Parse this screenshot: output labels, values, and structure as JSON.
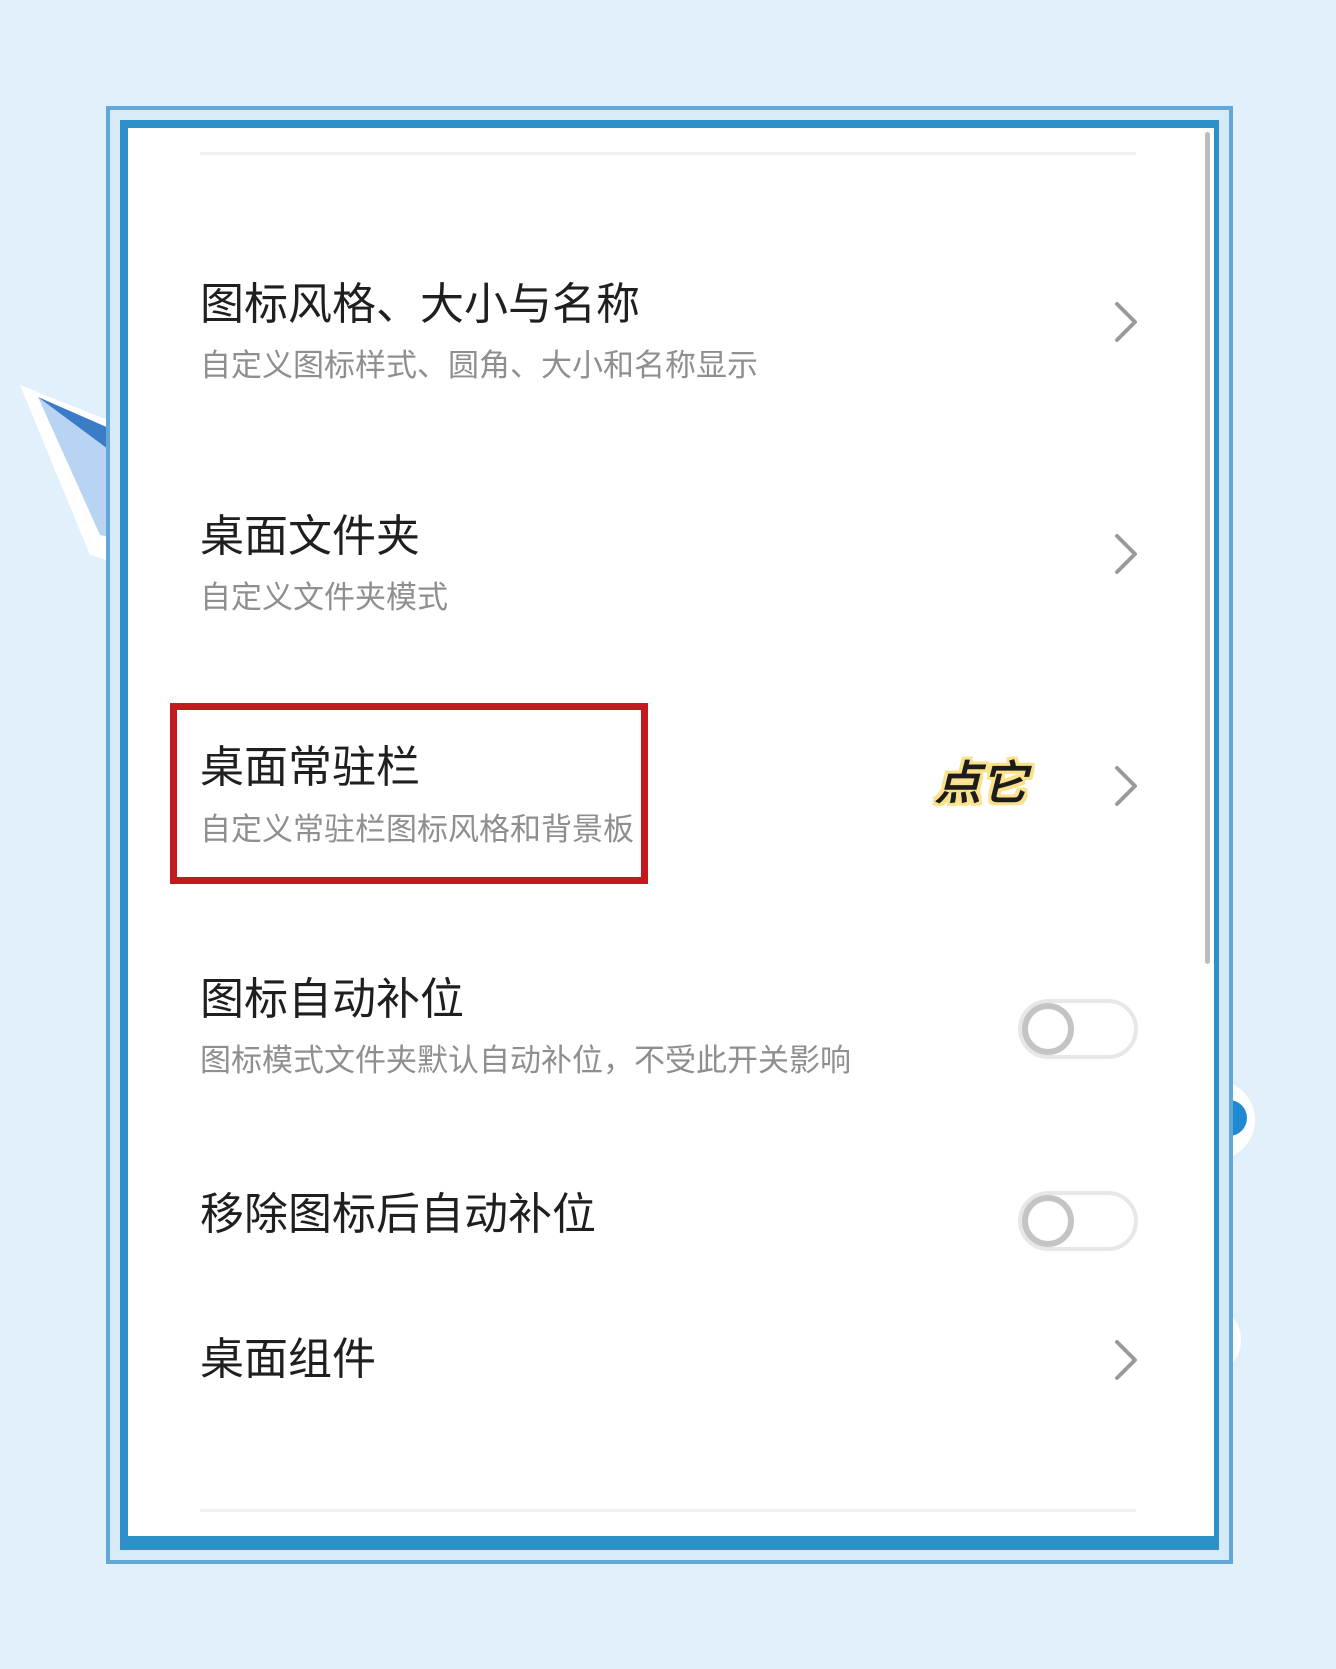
{
  "settings": {
    "items": [
      {
        "title": "图标风格、大小与名称",
        "subtitle": "自定义图标样式、圆角、大小和名称显示",
        "control": "chevron"
      },
      {
        "title": "桌面文件夹",
        "subtitle": "自定义文件夹模式",
        "control": "chevron"
      },
      {
        "title": "桌面常驻栏",
        "subtitle": "自定义常驻栏图标风格和背景板",
        "control": "chevron"
      },
      {
        "title": "图标自动补位",
        "subtitle": "图标模式文件夹默认自动补位，不受此开关影响",
        "control": "toggle",
        "toggle_on": false
      },
      {
        "title": "移除图标后自动补位",
        "subtitle": "",
        "control": "toggle",
        "toggle_on": false
      },
      {
        "title": "桌面组件",
        "subtitle": "",
        "control": "chevron"
      }
    ]
  },
  "annotation": {
    "tap_label": "点它",
    "highlight_color": "#c4191d",
    "label_outline_color": "#fbe28a"
  },
  "icons": {
    "chevron": "chevron-right-icon",
    "plane": "paper-plane-icon",
    "flower": "flower-icon"
  },
  "colors": {
    "background": "#e2f0fb",
    "frame": "#2f8fc9",
    "title_text": "#1f1f1f",
    "subtitle_text": "#8f8f8f"
  }
}
